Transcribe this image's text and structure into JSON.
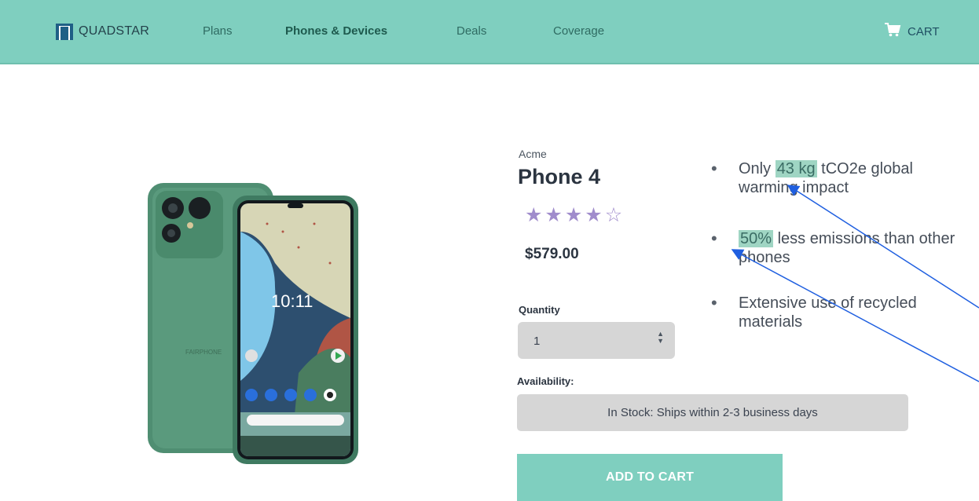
{
  "brand": {
    "name": "QUADSTAR",
    "colors": {
      "header": "#7fcfbf",
      "accent": "#7fcfbf",
      "stars": "#a08ccc",
      "highlight": "#9fd5c3"
    }
  },
  "nav": {
    "items": [
      {
        "label": "Plans",
        "active": false
      },
      {
        "label": "Phones & Devices",
        "active": true
      },
      {
        "label": "Deals",
        "active": false
      },
      {
        "label": "Coverage",
        "active": false
      }
    ]
  },
  "cart": {
    "label": "CART",
    "icon": "cart-icon"
  },
  "product": {
    "brand": "Acme",
    "name": "Phone 4",
    "rating": 4,
    "rating_max": 5,
    "price": "$579.00",
    "image_clock": "10:11",
    "image_logo_text": "FAIRPHONE"
  },
  "quantity": {
    "label": "Quantity",
    "value": "1"
  },
  "availability": {
    "label": "Availability:",
    "status": "In Stock: Ships within 2-3 business days"
  },
  "add_to_cart": {
    "label": "ADD TO CART"
  },
  "highlights": [
    {
      "before": "Only ",
      "highlight": "43 kg",
      "after": " tCO2e global warming impact"
    },
    {
      "before": "",
      "highlight": "50%",
      "after": " less emissions than other phones"
    },
    {
      "before": "Extensive use of recycled materials",
      "highlight": "",
      "after": ""
    }
  ],
  "icons": {
    "logo": "quadstar-logo-icon",
    "cart": "cart-icon",
    "select": "updown-arrows-icon",
    "star": "star-icon"
  }
}
